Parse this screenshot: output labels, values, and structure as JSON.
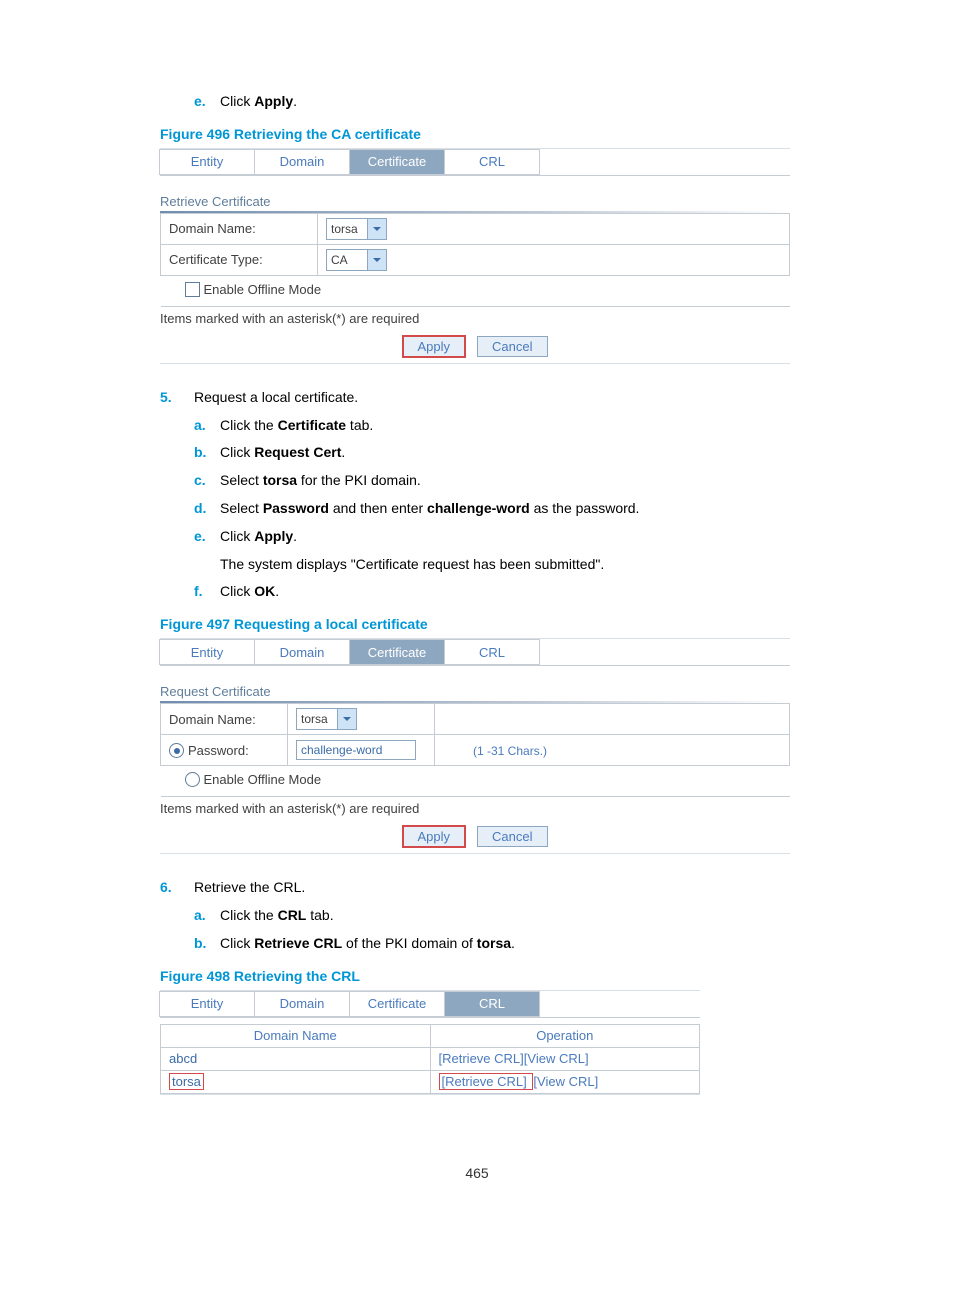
{
  "page_number": "465",
  "step4_sub": {
    "e_marker": "e.",
    "e_1": "Click ",
    "e_b": "Apply",
    "e_2": "."
  },
  "fig496": {
    "caption": "Figure 496 Retrieving the CA certificate",
    "tabs": {
      "entity": "Entity",
      "domain": "Domain",
      "certificate": "Certificate",
      "crl": "CRL"
    },
    "section": "Retrieve Certificate",
    "domain_label": "Domain Name:",
    "domain_value": "torsa",
    "certtype_label": "Certificate Type:",
    "certtype_value": "CA",
    "offline_label": "Enable Offline Mode",
    "hint": "Items marked with an asterisk(*) are required",
    "apply": "Apply",
    "cancel": "Cancel"
  },
  "step5": {
    "marker": "5.",
    "text": "Request a local certificate.",
    "a": {
      "m": "a.",
      "t1": "Click the ",
      "b": "Certificate",
      "t2": " tab."
    },
    "b": {
      "m": "b.",
      "t1": "Click ",
      "b": "Request Cert",
      "t2": "."
    },
    "c": {
      "m": "c.",
      "t1": "Select ",
      "b": "torsa",
      "t2": " for the PKI domain."
    },
    "d": {
      "m": "d.",
      "t1": "Select ",
      "b1": "Password",
      "t2": " and then enter ",
      "b2": "challenge-word",
      "t3": " as the password."
    },
    "e": {
      "m": "e.",
      "t1": "Click ",
      "b": "Apply",
      "t2": "."
    },
    "note": "The system displays \"Certificate request has been submitted\".",
    "f": {
      "m": "f.",
      "t1": "Click ",
      "b": "OK",
      "t2": "."
    }
  },
  "fig497": {
    "caption": "Figure 497 Requesting a local certificate",
    "tabs": {
      "entity": "Entity",
      "domain": "Domain",
      "certificate": "Certificate",
      "crl": "CRL"
    },
    "section": "Request Certificate",
    "domain_label": "Domain Name:",
    "domain_value": "torsa",
    "password_label": "Password:",
    "password_value": "challenge-word",
    "chars_hint": "(1 -31 Chars.)",
    "offline_label": "Enable Offline Mode",
    "hint": "Items marked with an asterisk(*) are required",
    "apply": "Apply",
    "cancel": "Cancel"
  },
  "step6": {
    "marker": "6.",
    "text": "Retrieve the CRL.",
    "a": {
      "m": "a.",
      "t1": "Click the ",
      "b": "CRL",
      "t2": " tab."
    },
    "b": {
      "m": "b.",
      "t1": "Click ",
      "b": "Retrieve CRL",
      "t2": " of the PKI domain of ",
      "b2": "torsa",
      "t3": "."
    }
  },
  "fig498": {
    "caption": "Figure 498 Retrieving the CRL",
    "tabs": {
      "entity": "Entity",
      "domain": "Domain",
      "certificate": "Certificate",
      "crl": "CRL"
    },
    "th_domain": "Domain Name",
    "th_operation": "Operation",
    "rows": [
      {
        "name": "abcd",
        "retrieve": "Retrieve CRL",
        "view": "View CRL"
      },
      {
        "name": "torsa",
        "retrieve": "Retrieve CRL",
        "view": "View CRL"
      }
    ]
  }
}
